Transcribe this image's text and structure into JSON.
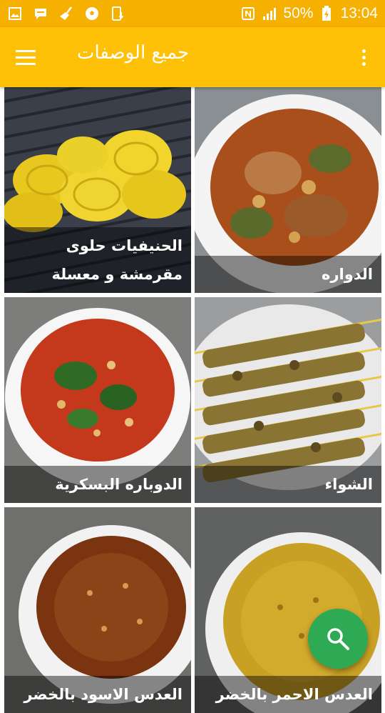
{
  "status_bar": {
    "battery": "50%",
    "time": "13:04",
    "left_icons": [
      "gallery-icon",
      "message-icon",
      "broom-icon",
      "soccer-ball-icon",
      "phone-download-icon"
    ],
    "right_icons": [
      "nfc-icon",
      "signal-icon",
      "battery-charging-icon"
    ]
  },
  "app_bar": {
    "title": "جميع الوصفات",
    "menu_icon": "hamburger-menu-icon",
    "overflow_icon": "more-vert-icon"
  },
  "recipes": [
    {
      "title": "الحنيفيات حلوى مقرمشة و معسلة",
      "image": "yellow-pastry-rolls"
    },
    {
      "title": "الدواره",
      "image": "stew-white-plate"
    },
    {
      "title": "الدوباره البسكرية",
      "image": "red-soup-herbs"
    },
    {
      "title": "الشواء",
      "image": "grilled-skewers"
    },
    {
      "title": "العدس الاسود بالخضر",
      "image": "brown-lentil-soup"
    },
    {
      "title": "العدس الاحمر بالخضر",
      "image": "red-lentil-soup"
    }
  ],
  "fab": {
    "icon": "search-icon"
  },
  "colors": {
    "status_bar": "#f5b000",
    "app_bar": "#ffc107",
    "fab": "#2eaa55"
  }
}
